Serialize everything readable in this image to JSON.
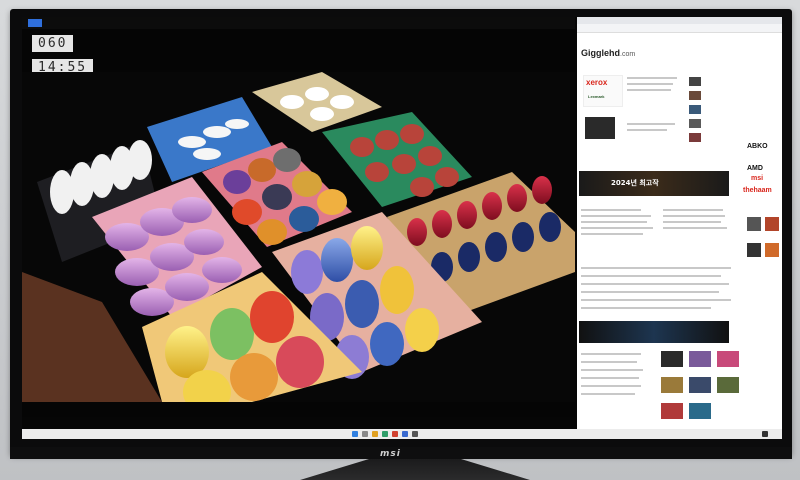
{
  "monitor": {
    "brand": "msi"
  },
  "player": {
    "fps": "060",
    "time": "14:55"
  },
  "browser": {
    "site_name": "Gigglehd",
    "site_suffix": ".com",
    "banner": "2024년 최고작",
    "brands": [
      "xerox",
      "Lexmark",
      "ABKO",
      "AMD",
      "msi",
      "thehaam"
    ]
  },
  "colors": {
    "osd_bg": "#e6e6e6",
    "site_accent": "#d9261c"
  }
}
